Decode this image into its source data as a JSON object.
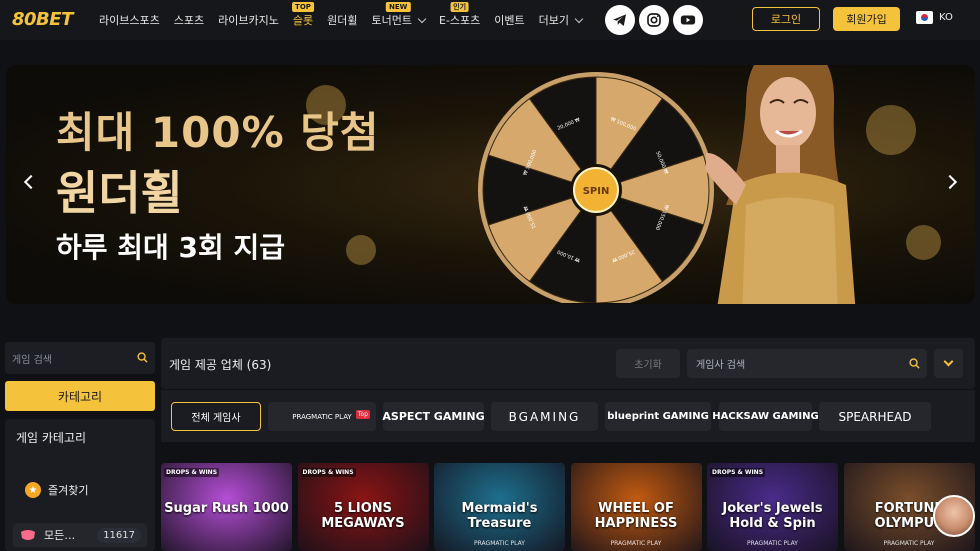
{
  "brand": {
    "logo": "80BET"
  },
  "nav": [
    {
      "label": "라이브스포츠",
      "badge": "",
      "dropdown": false,
      "active": false
    },
    {
      "label": "스포츠",
      "badge": "",
      "dropdown": false,
      "active": false
    },
    {
      "label": "라이브카지노",
      "badge": "",
      "dropdown": false,
      "active": false
    },
    {
      "label": "슬롯",
      "badge": "TOP",
      "dropdown": false,
      "active": true
    },
    {
      "label": "원더휠",
      "badge": "",
      "dropdown": false,
      "active": false
    },
    {
      "label": "토너먼트",
      "badge": "NEW",
      "dropdown": true,
      "active": false
    },
    {
      "label": "E-스포츠",
      "badge": "인기",
      "dropdown": false,
      "active": false
    },
    {
      "label": "이벤트",
      "badge": "",
      "dropdown": false,
      "active": false
    },
    {
      "label": "더보기",
      "badge": "",
      "dropdown": true,
      "active": false
    }
  ],
  "social": [
    "telegram-icon",
    "instagram-icon",
    "youtube-icon"
  ],
  "auth": {
    "login": "로그인",
    "join": "회원가입"
  },
  "language": {
    "code": "KO"
  },
  "banner": {
    "line1": "최대 100% 당첨",
    "line2": "원더휠",
    "line3": "하루 최대 3회 지급",
    "wheel_center": "SPIN",
    "wheel_labels": [
      "₩ 100,000",
      "50,000 ₩",
      "₩ 150,000",
      "25,000 ₩",
      "₩ 10,000",
      "15,000 ₩",
      "₩ 500,000",
      "20,000 ₩"
    ]
  },
  "sidebar": {
    "search_placeholder": "게임 검색",
    "category_button": "카테고리",
    "title": "게임 카테고리",
    "items": [
      {
        "label": "즐겨찾기",
        "icon": "star-icon"
      },
      {
        "label": "모든…",
        "icon": "all-games-icon",
        "count": "11617"
      }
    ]
  },
  "providers": {
    "title": "게임 제공 업체 (63)",
    "reset": "초기화",
    "search_placeholder": "게임사 검색",
    "list": [
      {
        "label": "전체 게임사",
        "selected": true
      },
      {
        "label": "PRAGMATIC PLAY",
        "tag": "Top"
      },
      {
        "label": "ASPECT GAMING"
      },
      {
        "label": "BGAMING"
      },
      {
        "label": "blueprint GAMING"
      },
      {
        "label": "HACKSAW GAMING"
      },
      {
        "label": "SPEARHEAD"
      }
    ]
  },
  "games": [
    {
      "title": "Sugar Rush 1000",
      "tag": "DROPS & WINS",
      "provider": "",
      "bg": "#b54ed6"
    },
    {
      "title": "5 LIONS MEGAWAYS",
      "tag": "DROPS & WINS",
      "provider": "",
      "bg": "#8a1414"
    },
    {
      "title": "Mermaid's Treasure",
      "tag": "",
      "provider": "PRAGMATIC PLAY",
      "bg": "#1d6f8e"
    },
    {
      "title": "WHEEL OF HAPPINESS",
      "tag": "",
      "provider": "PRAGMATIC PLAY",
      "bg": "#c25a10"
    },
    {
      "title": "Joker's Jewels Hold & Spin",
      "tag": "DROPS & WINS",
      "provider": "PRAGMATIC PLAY",
      "bg": "#4a2b8a"
    },
    {
      "title": "FORTUNE OLYMPUS",
      "tag": "",
      "provider": "PRAGMATIC PLAY",
      "bg": "#7a4e2a"
    }
  ]
}
